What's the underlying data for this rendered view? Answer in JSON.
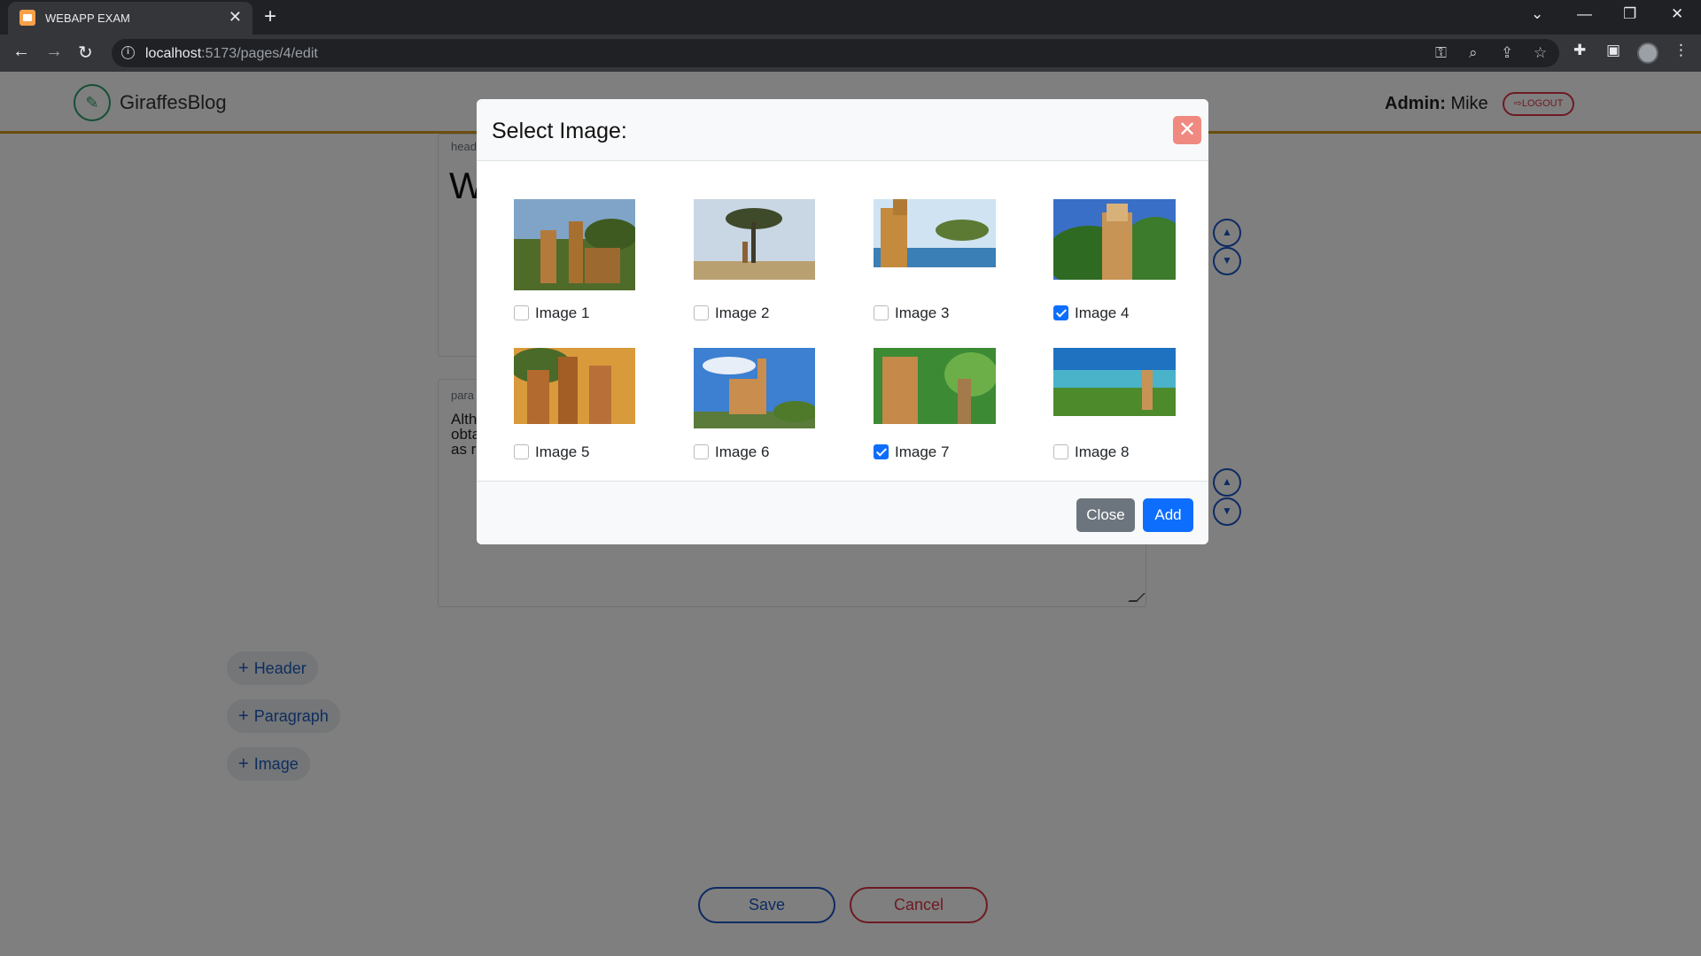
{
  "browser": {
    "tab_title": "WEBAPP EXAM",
    "url_host": "localhost",
    "url_path": ":5173/pages/4/edit"
  },
  "app": {
    "brand": "GiraffesBlog",
    "admin_label": "Admin:",
    "admin_name": "Mike",
    "logout_label": "LOGOUT"
  },
  "editor": {
    "block1_label": "head",
    "block1_text": "W",
    "block2_label": "para",
    "block2_lines": [
      "Alth",
      "obta",
      "as ri"
    ]
  },
  "add_buttons": [
    {
      "label": "Header"
    },
    {
      "label": "Paragraph"
    },
    {
      "label": "Image"
    }
  ],
  "actions": {
    "save": "Save",
    "cancel": "Cancel"
  },
  "modal": {
    "title": "Select Image:",
    "close_label": "Close",
    "add_label": "Add",
    "images": [
      {
        "label": "Image 1",
        "checked": false
      },
      {
        "label": "Image 2",
        "checked": false
      },
      {
        "label": "Image 3",
        "checked": false
      },
      {
        "label": "Image 4",
        "checked": true
      },
      {
        "label": "Image 5",
        "checked": false
      },
      {
        "label": "Image 6",
        "checked": false
      },
      {
        "label": "Image 7",
        "checked": true
      },
      {
        "label": "Image 8",
        "checked": false
      }
    ]
  },
  "colors": {
    "accent": "#0d6efd",
    "navbar_border": "#d49a1c",
    "danger": "#dc3545",
    "secondary": "#6c757d"
  }
}
